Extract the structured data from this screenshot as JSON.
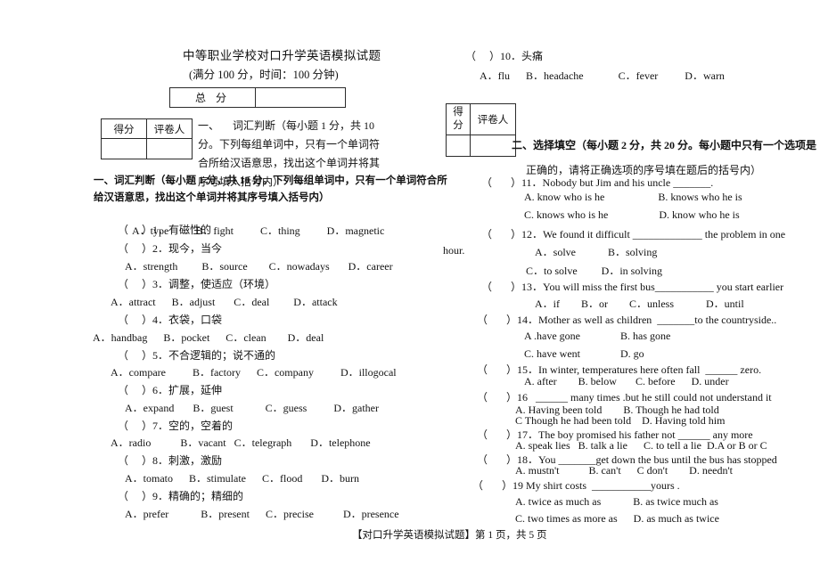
{
  "header": {
    "title": "中等职业学校对口升学英语模拟试题",
    "subtitle": "(满分 100 分，时间：100 分钟)"
  },
  "total_score_table": {
    "label": "总  分",
    "value": ""
  },
  "score_box_left": {
    "col1_header": "得分",
    "col2_header": "评卷人",
    "col1_value": "",
    "col2_value": ""
  },
  "score_box_right": {
    "col1_header": "得\n分",
    "col2_header": "评卷人",
    "col1_value": "",
    "col2_value": ""
  },
  "section1": {
    "header_boxed": "一、     词汇判断（每小题 1 分，共 10 分。下列每组单词中，只有一个单词符合所给汉语意思，找出这个单词并将其序号填入括号内）",
    "header_repeat": "一、词汇判断（每小题 1 分，共 10 分。下列每组单词中，只有一个单词符合所给汉语意思，找出这个单词并将其序号填入括号内）",
    "questions": [
      {
        "num": "1",
        "prompt": "（     ）1．有磁性的",
        "options": "A．type          B．fight          C．thing          D．magnetic"
      },
      {
        "num": "2",
        "prompt": "（     ）2．现今，当今",
        "options": "A．strength         B．source        C．nowadays       D．career"
      },
      {
        "num": "3",
        "prompt": "（     ）3．调整，使适应（环境）",
        "options": "A．attract      B．adjust       C．deal         D．attack"
      },
      {
        "num": "4",
        "prompt": "（     ）4．衣袋，口袋",
        "options": "A．handbag      B．pocket      C．clean        D．deal"
      },
      {
        "num": "5",
        "prompt": "（     ）5．不合逻辑的；说不通的",
        "options": "A．compare          B．factory      C．company          D．illogocal"
      },
      {
        "num": "6",
        "prompt": "（     ）6．扩展，延伸",
        "options": "A．expand       B．guest            C．guess          D．gather"
      },
      {
        "num": "7",
        "prompt": "（     ）7．空的，空着的",
        "options": "A．radio           B．vacant   C．telegraph       D．telephone"
      },
      {
        "num": "8",
        "prompt": "（     ）8．刺激，激励",
        "options": "A．tomato      B．stimulate      C．flood       D．burn"
      },
      {
        "num": "9",
        "prompt": "（     ）9．精确的；精细的",
        "options": "A．prefer            B．present      C．precise           D．presence"
      },
      {
        "num": "10",
        "prompt": "（     ）10．头痛",
        "options": "A．flu      B．headache             C．fever          D．warn"
      }
    ]
  },
  "section2": {
    "header_line1": "二、选择填空（每小题 2 分，共 20 分。每小题中只有一个选项是",
    "header_line2": "正确的，请将正确选项的序号填在题后的括号内）",
    "questions": [
      {
        "num": "11",
        "prompt": "（       ）11．Nobody but Jim and his uncle _______.",
        "options_line1": "A. know who is he                    B. knows who he is",
        "options_line2": "C. knows who is he                   D. know who he is"
      },
      {
        "num": "12",
        "prompt": "（       ）12．We found it difficult _____________ the problem in one",
        "continuation": "hour.",
        "options_line1": "A．solve            B．solving",
        "options_line2": "C．to solve         D．in solving"
      },
      {
        "num": "13",
        "prompt": "（       ）13．You will miss the first bus___________ you start earlier",
        "options_line1": "A．if        B．or        C．unless            D．until"
      },
      {
        "num": "14",
        "prompt": "（       ）14．Mother as well as children  _______to the countryside..",
        "options_line1": "A .have gone               B. has gone",
        "options_line2": "C. have went               D. go"
      },
      {
        "num": "15",
        "prompt": "（       ）15．In winter, temperatures here often fall  ______ zero.",
        "options_line1": "A. after        B. below       C. before      D. under"
      },
      {
        "num": "16",
        "prompt": "（       ）16   ______ many times .but he still could not understand it",
        "options_line1": "A. Having been told        B. Though he had told",
        "options_line2": "C Though he had been told    D. Having told him"
      },
      {
        "num": "17",
        "prompt": "（       ）17．The boy promised his father not ______ any more",
        "options_line1": "A. speak lies   B. talk a lie      C. to tell a lie  D.A or B or C"
      },
      {
        "num": "18",
        "prompt": "（       ）18．You _______get down the bus until the bus has stopped",
        "options_line1": "A. mustn't           B. can't      C don't        D. needn't"
      },
      {
        "num": "19",
        "prompt": "（       ）19 My shirt costs  ___________yours .",
        "options_line1": "A. twice as much as            B. as twice much as",
        "options_line2": "C. two times as more as      D. as much as twice"
      }
    ]
  },
  "footer": "【对口升学英语模拟试题】第 1 页，共 5 页"
}
